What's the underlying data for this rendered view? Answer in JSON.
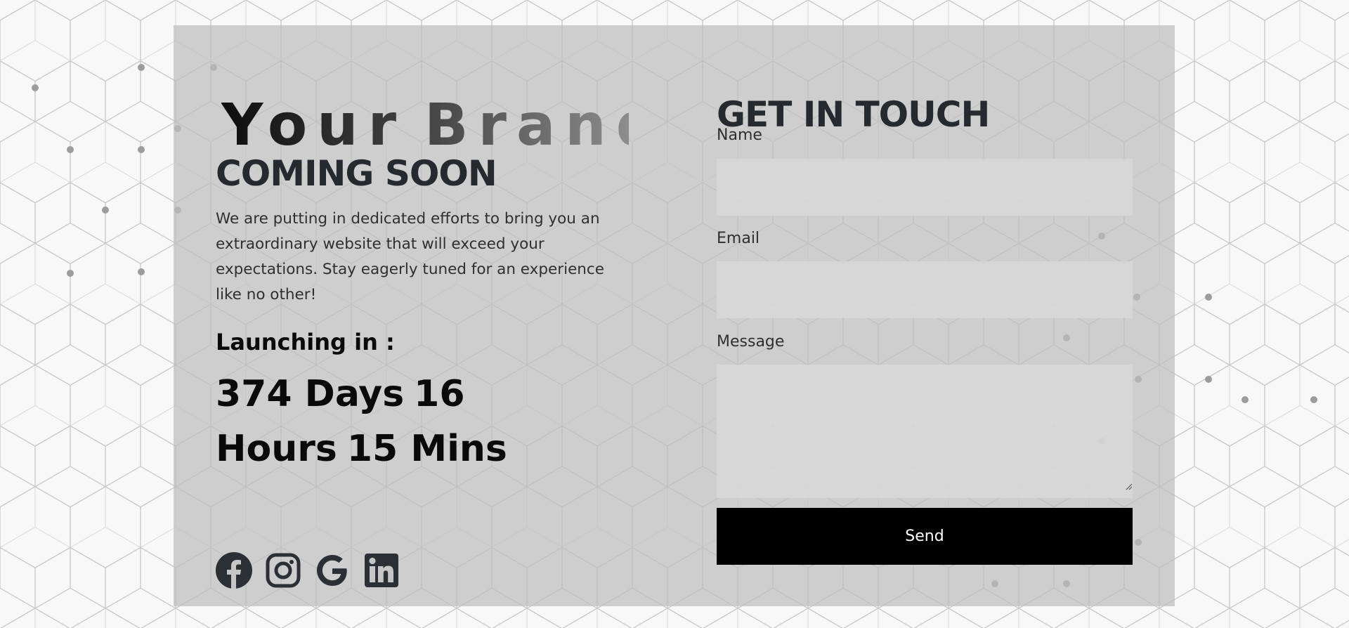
{
  "brand": {
    "word1": "Your",
    "word2": "Brand",
    "gradient_colors": [
      "#0d0d0d",
      "#4a4a4a",
      "#9a9a9a"
    ]
  },
  "heading": "COMING SOON",
  "description": "We are putting in dedicated efforts to bring you an extraordinary website that will exceed your expectations. Stay eagerly tuned for an experience like no other!",
  "launch": {
    "label": "Launching in :",
    "days": "374 Days",
    "hours": "16 Hours",
    "mins": "15 Mins"
  },
  "socials": [
    {
      "icon": "facebook-icon"
    },
    {
      "icon": "instagram-icon"
    },
    {
      "icon": "google-icon"
    },
    {
      "icon": "linkedin-icon"
    }
  ],
  "contact": {
    "title": "GET IN TOUCH",
    "name_label": "Name",
    "name_value": "",
    "email_label": "Email",
    "email_value": "",
    "message_label": "Message",
    "message_value": "",
    "send_label": "Send"
  },
  "colors": {
    "card_bg": "#c6c6c6",
    "heading_text": "#26292d",
    "button_bg": "#000000",
    "button_text": "#ffffff",
    "page_bg": "#f6f6f6"
  }
}
